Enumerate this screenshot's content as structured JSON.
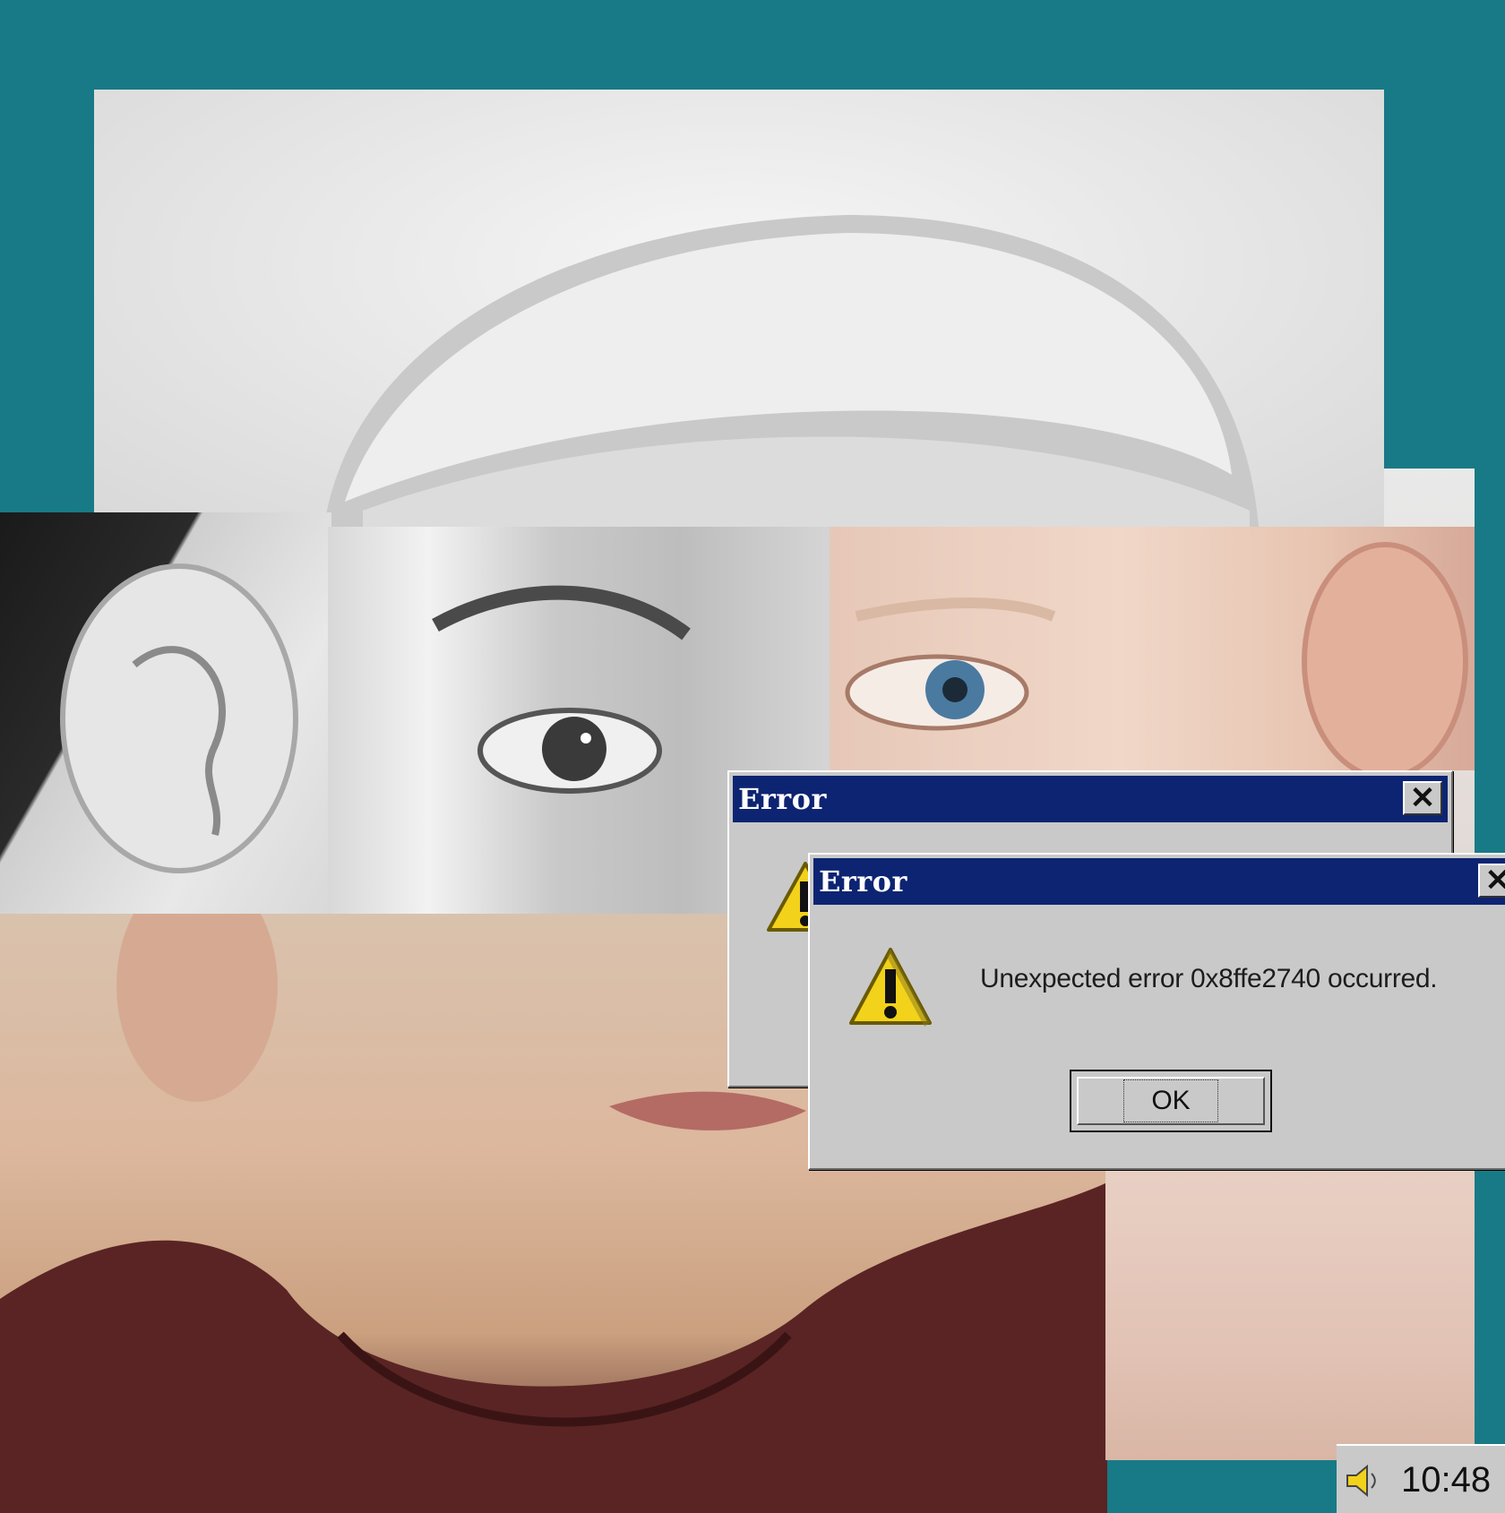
{
  "dialogs": [
    {
      "title": "Error",
      "close_label": "✕"
    },
    {
      "title": "Error",
      "close_label": "✕",
      "message": "Unexpected error 0x8ffe2740 occurred.",
      "ok_label": "OK"
    }
  ],
  "taskbar": {
    "time": "10:48",
    "tray_icon": "speaker-icon"
  },
  "colors": {
    "desktop": "#187a86",
    "titlebar": "#0d2472",
    "dialog_face": "#c9c9c9"
  },
  "icons": [
    "warning-icon",
    "close-icon",
    "speaker-icon"
  ]
}
